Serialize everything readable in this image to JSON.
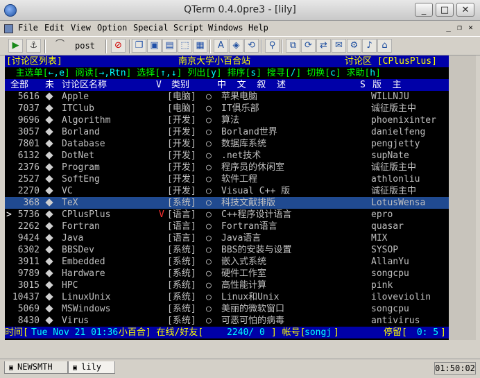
{
  "window": {
    "title": "QTerm 0.4.0pre3 - [lily]"
  },
  "menu": [
    "File",
    "Edit",
    "View",
    "Option",
    "Special",
    "Script",
    "Windows",
    "Help"
  ],
  "toolbar": {
    "post_label": "post"
  },
  "terminal": {
    "line1": {
      "left": "[讨论区列表]",
      "center": "南京大学小百合站",
      "right": "讨论区 [CPlusPlus]"
    },
    "line2": [
      {
        "t": "  主选单[",
        "c": "#00ff00"
      },
      {
        "t": "←,e",
        "c": "#00ffff"
      },
      {
        "t": "] 阅读[",
        "c": "#00ff00"
      },
      {
        "t": "→,Rtn",
        "c": "#00ffff"
      },
      {
        "t": "] 选择[",
        "c": "#00ff00"
      },
      {
        "t": "↑,↓",
        "c": "#00ffff"
      },
      {
        "t": "] 列出[",
        "c": "#00ff00"
      },
      {
        "t": "y",
        "c": "#00ffff"
      },
      {
        "t": "] 排序[",
        "c": "#00ff00"
      },
      {
        "t": "s",
        "c": "#00ffff"
      },
      {
        "t": "] 搜寻[",
        "c": "#00ff00"
      },
      {
        "t": "/",
        "c": "#00ffff"
      },
      {
        "t": "] 切换[",
        "c": "#00ff00"
      },
      {
        "t": "c",
        "c": "#00ffff"
      },
      {
        "t": "] 求助[",
        "c": "#00ff00"
      },
      {
        "t": "h",
        "c": "#00ffff"
      },
      {
        "t": "]",
        "c": "#00ff00"
      }
    ],
    "columns": {
      "all": "全部",
      "unread": "未",
      "name": "讨论区名称",
      "v": "V",
      "category": "类别",
      "desc": "中  文  叙  述",
      "s": "S",
      "owner": "版  主"
    },
    "rows": [
      {
        "num": "5616",
        "name": "Apple",
        "v": "",
        "cat": "[电脑]",
        "desc": "苹果电脑",
        "owner": "WILLNJU"
      },
      {
        "num": "7037",
        "name": "ITClub",
        "v": "",
        "cat": "[电脑]",
        "desc": "IT俱乐部",
        "owner": "诚征版主中"
      },
      {
        "num": "9696",
        "name": "Algorithm",
        "v": "",
        "cat": "[开发]",
        "desc": "算法",
        "owner": "phoenixinter"
      },
      {
        "num": "3057",
        "name": "Borland",
        "v": "",
        "cat": "[开发]",
        "desc": "Borland世界",
        "owner": "danielfeng"
      },
      {
        "num": "7801",
        "name": "Database",
        "v": "",
        "cat": "[开发]",
        "desc": "数据库系统",
        "owner": "pengjetty"
      },
      {
        "num": "6132",
        "name": "DotNet",
        "v": "",
        "cat": "[开发]",
        "desc": ".net技术",
        "owner": "supNate"
      },
      {
        "num": "2376",
        "name": "Program",
        "v": "",
        "cat": "[开发]",
        "desc": "程序员的休闲室",
        "owner": "诚征版主中"
      },
      {
        "num": "2527",
        "name": "SoftEng",
        "v": "",
        "cat": "[开发]",
        "desc": "软件工程",
        "owner": "athlonliu"
      },
      {
        "num": "2270",
        "name": "VC",
        "v": "",
        "cat": "[开发]",
        "desc": "Visual C++ 版",
        "owner": "诚征版主中"
      },
      {
        "num": "368",
        "name": "TeX",
        "v": "",
        "cat": "[系统]",
        "desc": "科技文献排版",
        "owner": "LotusWensa",
        "selected": true
      },
      {
        "num": "5736",
        "name": "CPlusPlus",
        "v": "V",
        "cat": "[语言]",
        "desc": "C++程序设计语言",
        "owner": "epro",
        "cursor": true
      },
      {
        "num": "2262",
        "name": "Fortran",
        "v": "",
        "cat": "[语言]",
        "desc": "Fortran语言",
        "owner": "quasar"
      },
      {
        "num": "9424",
        "name": "Java",
        "v": "",
        "cat": "[语言]",
        "desc": "Java语言",
        "owner": "MIX"
      },
      {
        "num": "6302",
        "name": "BBSDev",
        "v": "",
        "cat": "[系统]",
        "desc": "BBS的安装与设置",
        "owner": "SYSOP"
      },
      {
        "num": "3911",
        "name": "Embedded",
        "v": "",
        "cat": "[系统]",
        "desc": "嵌入式系统",
        "owner": "AllanYu"
      },
      {
        "num": "9789",
        "name": "Hardware",
        "v": "",
        "cat": "[系统]",
        "desc": "硬件工作室",
        "owner": "songcpu"
      },
      {
        "num": "3015",
        "name": "HPC",
        "v": "",
        "cat": "[系统]",
        "desc": "高性能计算",
        "owner": "pink"
      },
      {
        "num": "10437",
        "name": "LinuxUnix",
        "v": "",
        "cat": "[系统]",
        "desc": "Linux和Unix",
        "owner": "iloveviolin"
      },
      {
        "num": "5069",
        "name": "MSWindows",
        "v": "",
        "cat": "[系统]",
        "desc": "美丽的微软窗口",
        "owner": "songcpu"
      },
      {
        "num": "8430",
        "name": "Virus",
        "v": "",
        "cat": "[系统]",
        "desc": "可恶可怕的病毒",
        "owner": "antivirus"
      }
    ],
    "status": {
      "time_label": "时间[",
      "time_value": "Tue Nov 21 01:36",
      "site": " 小百合] 在线/好友[",
      "online": "2240/ 0",
      "acct_label": "] 帐号[",
      "account": "songj",
      "acct_close": "]",
      "stay_label": "停留[",
      "stay_value": " 0: 5",
      "stay_close": "]"
    }
  },
  "tabs": [
    "NEWSMTH",
    "lily"
  ],
  "clock": "01:50:02",
  "colors": {
    "terminal_bg": "#000000",
    "header_bar": "#0000a8",
    "selected_row": "#204a90",
    "title_yellow": "#ffff00",
    "green": "#00ff00",
    "cyan": "#00ffff"
  }
}
